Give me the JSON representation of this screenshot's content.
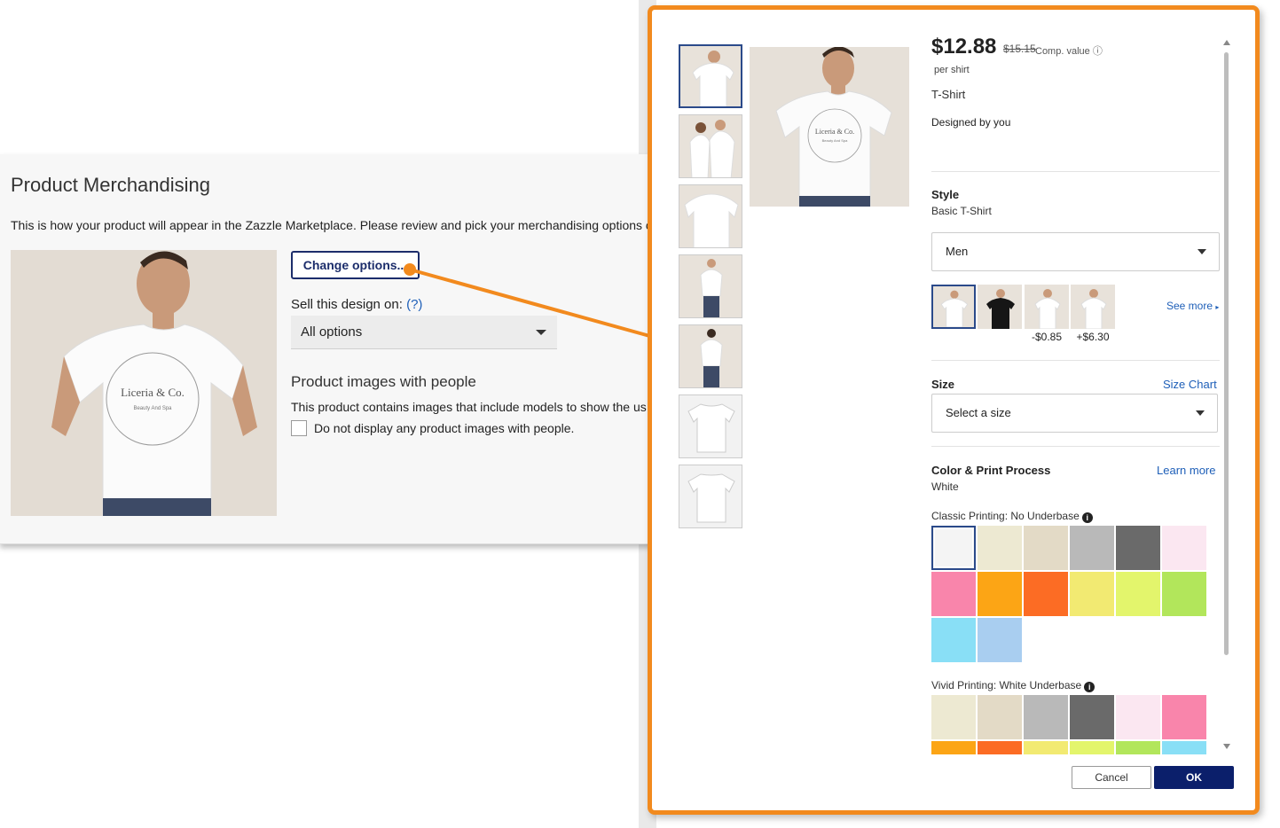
{
  "merch": {
    "title": "Product Merchandising",
    "description": "This is how your product will appear in the Zazzle Marketplace. Please review and pick your merchandising options c",
    "change_options": "Change options...",
    "sell_label": "Sell this design on:",
    "sell_help": "(?)",
    "sell_value": "All options",
    "people_title": "Product images with people",
    "people_desc": "This product contains images that include models to show the us",
    "people_checkbox": "Do not display any product images with people."
  },
  "shirt": {
    "brand_line1": "Liceria & Co.",
    "brand_line2": "Beauty And Spa"
  },
  "modal": {
    "price": "$12.88",
    "old_price": "$15.15",
    "comp_value": "Comp. value",
    "per_unit": "per shirt",
    "product_type": "T-Shirt",
    "designed_by": "Designed by you",
    "style": {
      "title": "Style",
      "value": "Basic T-Shirt",
      "selected": "Men",
      "see_more": "See more",
      "swatches": [
        {
          "price": "",
          "color": "#ffffff"
        },
        {
          "price": "",
          "color": "#111111"
        },
        {
          "price": "-$0.85",
          "color": "#ffffff"
        },
        {
          "price": "+$6.30",
          "color": "#ffffff"
        }
      ]
    },
    "size": {
      "title": "Size",
      "chart_link": "Size Chart",
      "placeholder": "Select a size"
    },
    "color": {
      "title": "Color & Print Process",
      "value": "White",
      "learn_more": "Learn more",
      "classic_label": "Classic Printing: No Underbase",
      "classic_colors": [
        "#f4f4f4",
        "#ede9d2",
        "#e3dac6",
        "#b9b9b9",
        "#6a6a6a",
        "#fbe7f1",
        "#f985ab",
        "#fca515",
        "#fc6c24",
        "#f2ea72",
        "#e3f56c",
        "#b2e65b",
        "#89dff6",
        "#a9cef0"
      ],
      "vivid_label": "Vivid Printing: White Underbase",
      "vivid_colors": [
        "#ede9d2",
        "#e3dac6",
        "#b9b9b9",
        "#6a6a6a",
        "#fbe7f1",
        "#f985ab",
        "#fca515",
        "#fc6c24",
        "#f2ea72",
        "#e3f56c",
        "#b2e65b",
        "#89dff6"
      ]
    },
    "cancel": "Cancel",
    "ok": "OK"
  },
  "colors": {
    "accent_orange": "#f28a1e",
    "primary_navy": "#0b1f6b",
    "link_blue": "#1e5fb8"
  }
}
